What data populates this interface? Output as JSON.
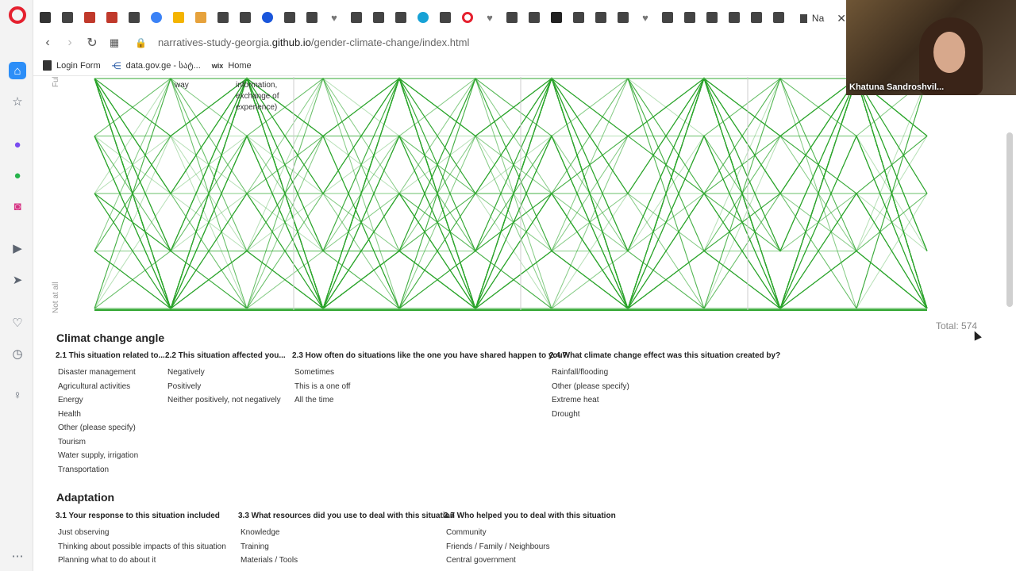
{
  "browser": {
    "active_tab_title": "Na",
    "url_prefix": "narratives-study-georgia.",
    "url_domain": "github.io",
    "url_path": "/gender-climate-change/index.html",
    "bookmarks": [
      "Login Form",
      "data.gov.ge - სატ...",
      "Home"
    ],
    "tab_icons": [
      "ID",
      "doc",
      "tool",
      "tool",
      "doc",
      "target",
      "slides",
      "g",
      "doc",
      "doc",
      "C",
      "doc",
      "doc",
      "heart",
      "doc",
      "doc",
      "doc",
      "CEF",
      "doc",
      "O",
      "heart",
      "doc",
      "doc",
      "wix",
      "doc",
      "doc",
      "doc",
      "heart",
      "doc",
      "doc",
      "doc",
      "doc",
      "doc",
      "doc"
    ]
  },
  "webcam": {
    "name": "Khatuna Sandroshvil..."
  },
  "chart": {
    "y_top_label": "Ful",
    "y_bottom_label": "Not at all",
    "top_labels": [
      "way",
      "information,",
      "exchange of",
      "experience)"
    ],
    "line_color": "#2ea52e",
    "total": "Total: 574"
  },
  "chart_data": {
    "type": "parallel-coordinates",
    "total": 574
  },
  "climate": {
    "title": "Climat change angle",
    "columns": [
      {
        "title": "2.1 This situation related to...",
        "options": [
          "Disaster management",
          "Agricultural activities",
          "Energy",
          "Health",
          "Other (please specify)",
          "Tourism",
          "Water supply, irrigation",
          "Transportation"
        ]
      },
      {
        "title": "2.2 This situation affected you...",
        "options": [
          "Negatively",
          "Positively",
          "Neither positively, not negatively"
        ]
      },
      {
        "title": "2.3 How often do situations like the one you have shared happen to you?",
        "options": [
          "Sometimes",
          "This is a one off",
          "All the time"
        ]
      },
      {
        "title": "2.4 What climate change effect was this situation created by?",
        "options": [
          "Rainfall/flooding",
          "Other (please specify)",
          "Extreme heat",
          "Drought"
        ]
      }
    ]
  },
  "adaptation": {
    "title": "Adaptation",
    "columns": [
      {
        "title": "3.1 Your response to this situation included",
        "options": [
          "Just observing",
          "Thinking about possible impacts of this situation",
          "Planning what to do about it"
        ]
      },
      {
        "title": "3.3 What resources did you use to deal with this situation",
        "options": [
          "Knowledge",
          "Training",
          "Materials / Tools"
        ]
      },
      {
        "title": "3.7 Who helped you to deal with this situation",
        "options": [
          "Community",
          "Friends / Family / Neighbours",
          "Central government"
        ]
      }
    ]
  }
}
